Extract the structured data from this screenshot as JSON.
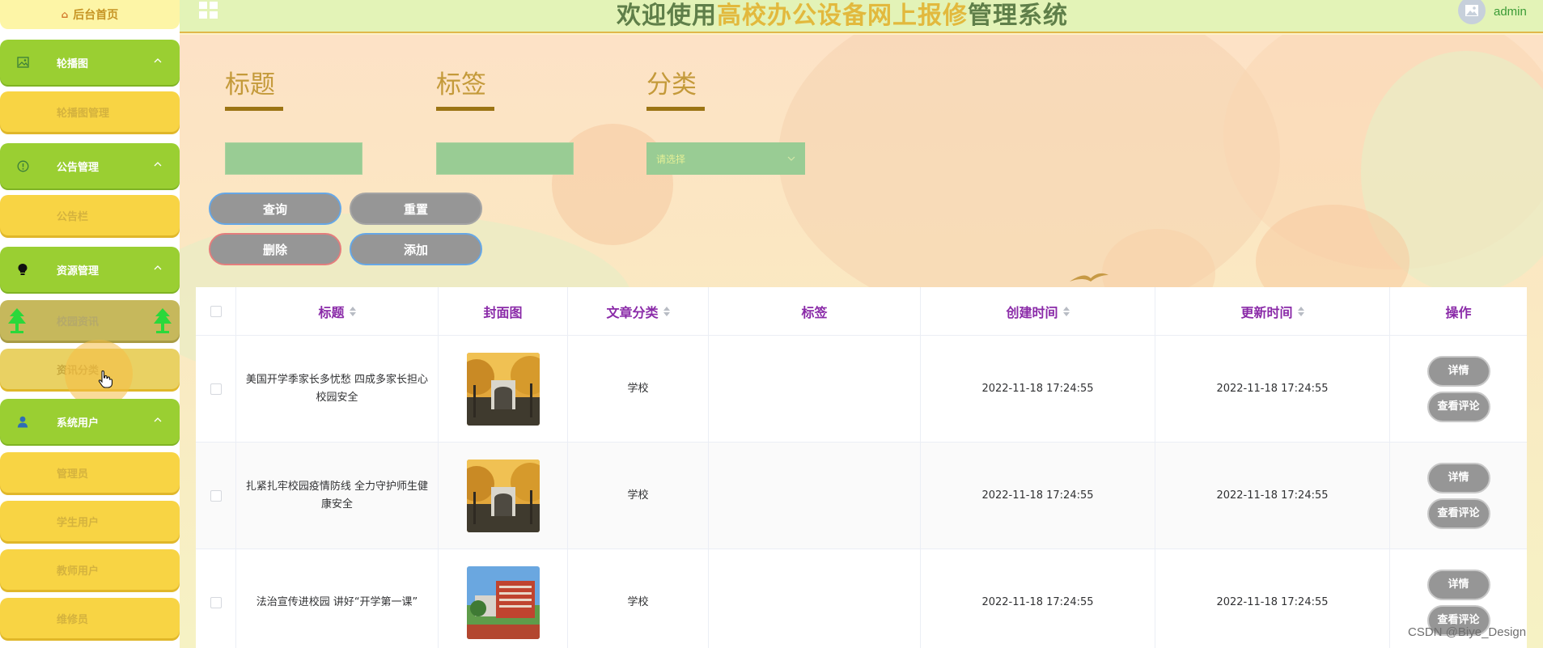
{
  "sidebar": {
    "home_label": "后台首页",
    "groups": [
      {
        "label": "轮播图",
        "icon": "image-icon",
        "children": [
          "轮播图管理"
        ]
      },
      {
        "label": "公告管理",
        "icon": "info-circle-icon",
        "children": [
          "公告栏"
        ]
      },
      {
        "label": "资源管理",
        "icon": "bulb-icon",
        "children": [
          "校园资讯",
          "资讯分类"
        ]
      },
      {
        "label": "系统用户",
        "icon": "user-icon",
        "children": [
          "管理员",
          "学生用户",
          "教师用户",
          "维修员"
        ]
      }
    ]
  },
  "header": {
    "title_part1": "欢迎使用",
    "title_part2": "高校办公设备网上报修",
    "title_part3": "管理系统",
    "username": "admin"
  },
  "filters": {
    "title_label": "标题",
    "tag_label": "标签",
    "category_label": "分类",
    "title_value": "",
    "tag_value": "",
    "category_placeholder": "请选择"
  },
  "buttons": {
    "query": "查询",
    "reset": "重置",
    "delete": "删除",
    "add": "添加"
  },
  "table": {
    "columns": [
      "标题",
      "封面图",
      "文章分类",
      "标签",
      "创建时间",
      "更新时间",
      "操作"
    ],
    "rows": [
      {
        "title": "美国开学季家长多忧愁 四成多家长担心校园安全",
        "category": "学校",
        "tag": "",
        "created": "2022-11-18 17:24:55",
        "updated": "2022-11-18 17:24:55",
        "cover": "autumn-gate-photo"
      },
      {
        "title": "扎紧扎牢校园疫情防线 全力守护师生健康安全",
        "category": "学校",
        "tag": "",
        "created": "2022-11-18 17:24:55",
        "updated": "2022-11-18 17:24:55",
        "cover": "autumn-gate-photo"
      },
      {
        "title": "法治宣传进校园 讲好“开学第一课”",
        "category": "学校",
        "tag": "",
        "created": "2022-11-18 17:24:55",
        "updated": "2022-11-18 17:24:55",
        "cover": "campus-building-photo"
      }
    ],
    "detail_label": "详情",
    "comments_label": "查看评论"
  },
  "watermark": "CSDN @Biye_Design",
  "colors": {
    "sidebar_group": "#9acf32",
    "sidebar_sub": "#f8d444",
    "header_bg": "#e3f3b7",
    "title_green": "#5f7f49",
    "title_gold": "#e2b93d",
    "column_header": "#8a2aa8",
    "button_gray": "#969696",
    "filter_input": "#99cc94"
  }
}
